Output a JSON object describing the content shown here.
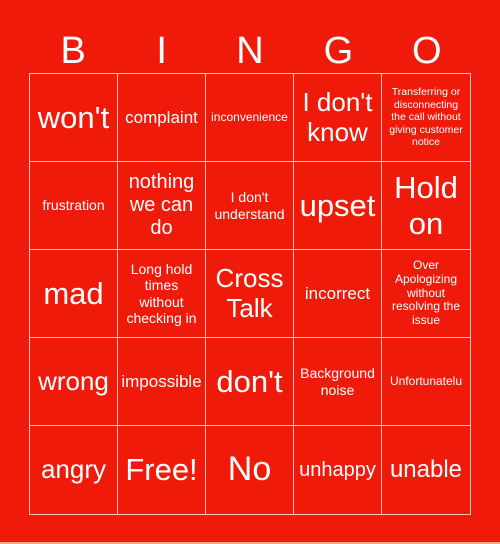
{
  "header": {
    "letters": [
      "B",
      "I",
      "N",
      "G",
      "O"
    ]
  },
  "colors": {
    "background": "#F01A0A",
    "text": "#FFFFFF",
    "grid_line": "#F8B4AC"
  },
  "grid": [
    [
      "won't",
      "complaint",
      "inconvenience",
      "I don't know",
      "Transferring or disconnecting the call without giving customer notice"
    ],
    [
      "frustration",
      "nothing we can do",
      "I don't understand",
      "upset",
      "Hold on"
    ],
    [
      "mad",
      "Long hold times without checking in",
      "Cross Talk",
      "incorrect",
      "Over Apologizing without resolving the issue"
    ],
    [
      "wrong",
      "impossible",
      "don't",
      "Background noise",
      "Unfortunatelu"
    ],
    [
      "angry",
      "Free!",
      "No",
      "unhappy",
      "unable"
    ]
  ]
}
